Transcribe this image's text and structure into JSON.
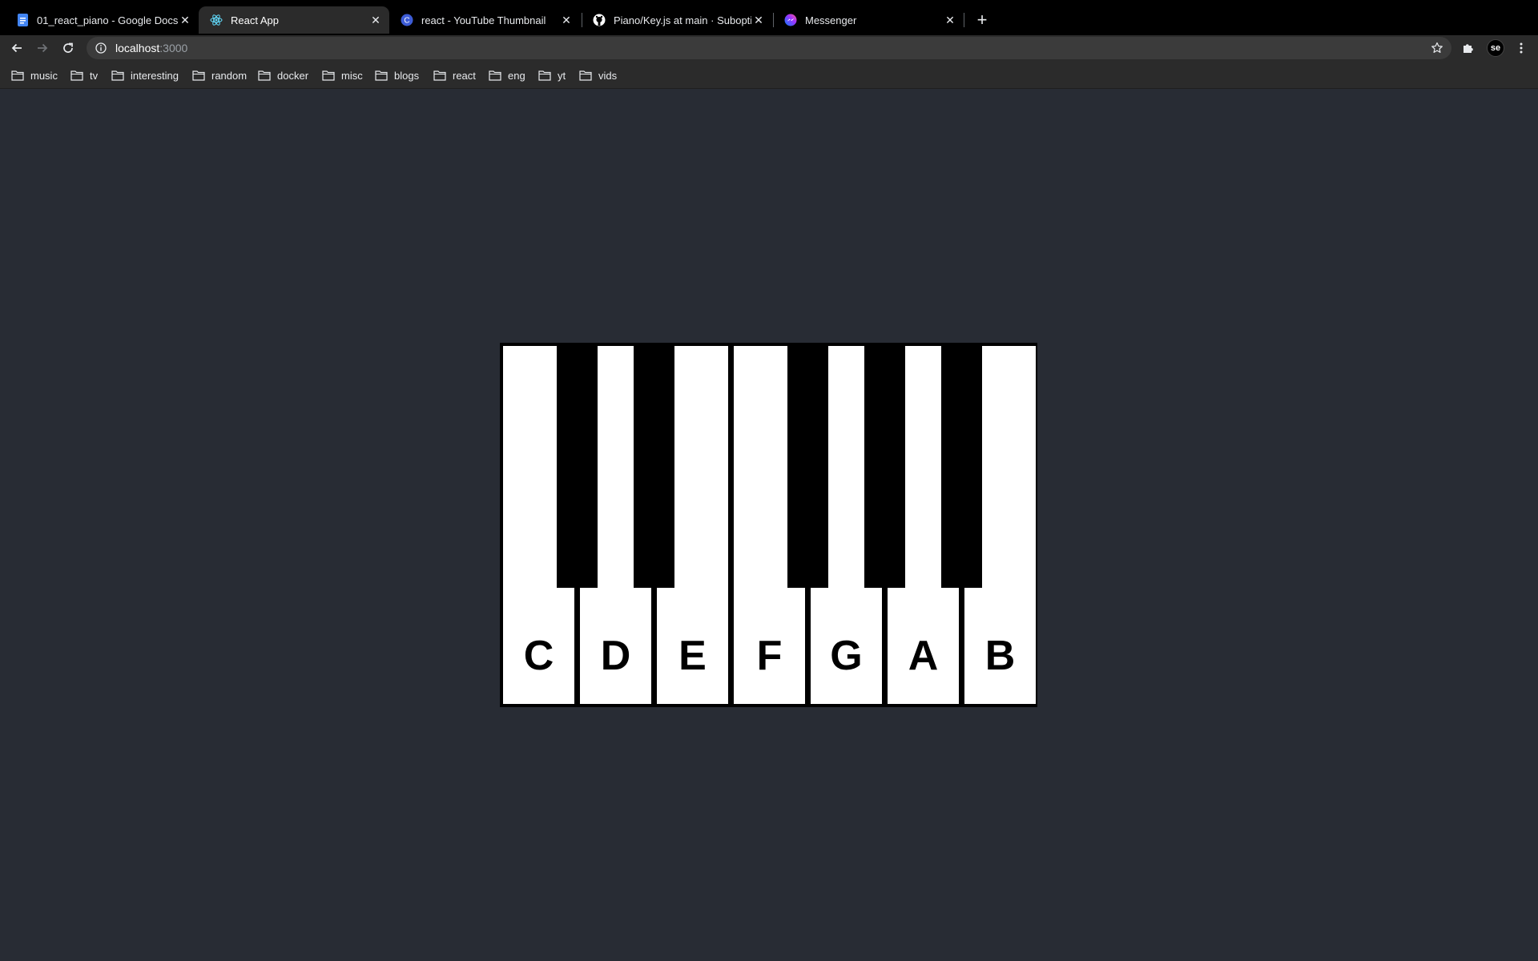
{
  "browser": {
    "tabs": [
      {
        "title": "01_react_piano - Google Docs",
        "icon": "google-docs-icon",
        "active": false
      },
      {
        "title": "React App",
        "icon": "react-icon",
        "active": true
      },
      {
        "title": "react - YouTube Thumbnail",
        "icon": "canva-icon",
        "active": false
      },
      {
        "title": "Piano/Key.js at main · Suboptim",
        "icon": "github-icon",
        "active": false
      },
      {
        "title": "Messenger",
        "icon": "messenger-icon",
        "active": false
      }
    ],
    "new_tab_label": "+",
    "url_host": "localhost",
    "url_port": ":3000",
    "profile_initials": "se",
    "bookmarks": [
      "music",
      "tv",
      "interesting",
      "random",
      "docker",
      "misc",
      "blogs",
      "react",
      "eng",
      "yt",
      "vids"
    ]
  },
  "piano": {
    "white_keys": [
      "C",
      "D",
      "E",
      "F",
      "G",
      "A",
      "B"
    ],
    "black_keys": [
      "C#",
      "D#",
      "F#",
      "G#",
      "A#"
    ]
  },
  "colors": {
    "page_background": "#282c34",
    "tabstrip_background": "#000000",
    "toolbar_background": "#2b2b2b",
    "white_key": "#ffffff",
    "black_key": "#000000"
  }
}
